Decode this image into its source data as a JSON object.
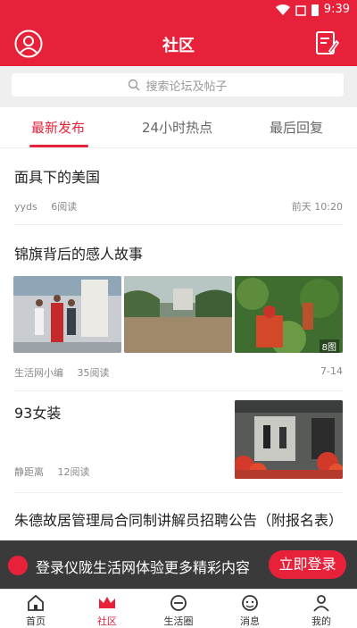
{
  "status": {
    "time": "9:39"
  },
  "header": {
    "title": "社区"
  },
  "search": {
    "placeholder": "搜索论坛及帖子"
  },
  "tabs": [
    {
      "label": "最新发布",
      "active": true
    },
    {
      "label": "24小时热点",
      "active": false
    },
    {
      "label": "最后回复",
      "active": false
    }
  ],
  "posts": [
    {
      "title": "面具下的美国",
      "author": "yyds",
      "reads": "6阅读",
      "time": "前天 10:20"
    },
    {
      "title": "锦旗背后的感人故事",
      "author": "生活网小编",
      "reads": "35阅读",
      "time": "7-14",
      "image_count": "8图"
    },
    {
      "title": "93女装",
      "author": "静距离",
      "reads": "12阅读"
    },
    {
      "title": "朱德故居管理局合同制讲解员招聘公告（附报名表）"
    }
  ],
  "banner": {
    "text": "登录仪陇生活网体验更多精彩内容",
    "button": "立即登录"
  },
  "bottom_nav": [
    {
      "label": "首页",
      "icon": "home-icon"
    },
    {
      "label": "社区",
      "icon": "crown-icon",
      "active": true
    },
    {
      "label": "生活圈",
      "icon": "circle-minus-icon"
    },
    {
      "label": "消息",
      "icon": "message-face-icon"
    },
    {
      "label": "我的",
      "icon": "person-icon"
    }
  ],
  "colors": {
    "brand": "#e8213b"
  }
}
